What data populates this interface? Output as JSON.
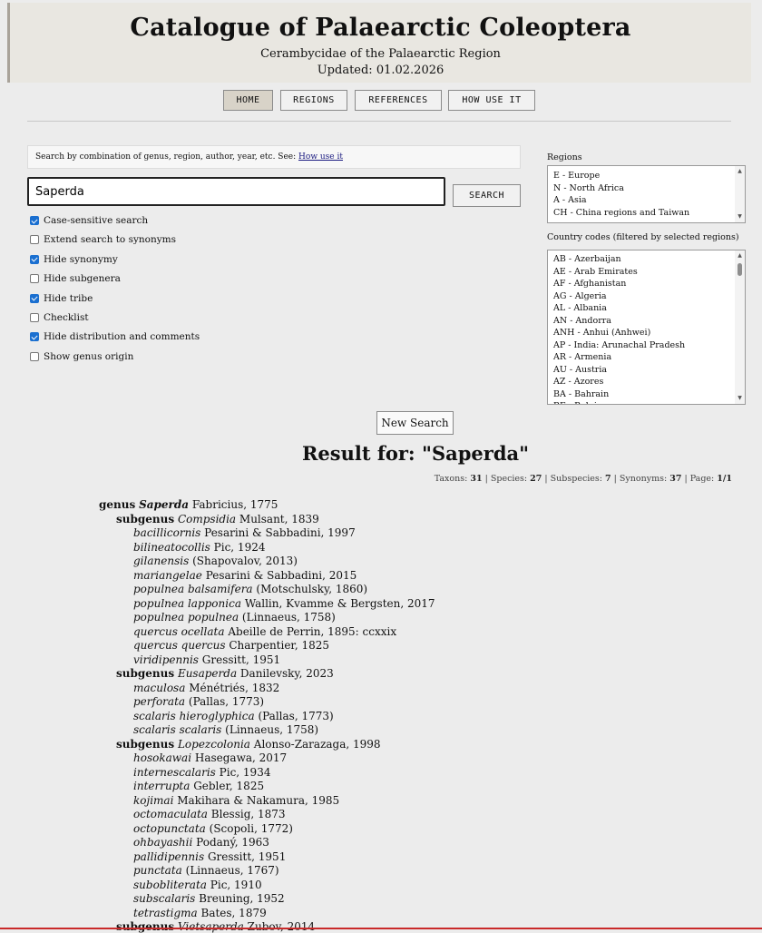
{
  "header": {
    "title": "Catalogue of Palaearctic Coleoptera",
    "subtitle": "Cerambycidae of the Palaearctic Region",
    "updated": "Updated: 01.02.2026"
  },
  "nav": [
    {
      "label": "HOME",
      "active": true
    },
    {
      "label": "REGIONS",
      "active": false
    },
    {
      "label": "REFERENCES",
      "active": false
    },
    {
      "label": "HOW USE IT",
      "active": false
    }
  ],
  "search": {
    "hint_text": "Search by combination of genus, region, author, year, etc. See:",
    "hint_link": "How use it",
    "value": "Saperda",
    "button": "SEARCH"
  },
  "options": [
    {
      "label": "Case-sensitive search",
      "checked": true
    },
    {
      "label": "Extend search to synonyms",
      "checked": false
    },
    {
      "label": "Hide synonymy",
      "checked": true
    },
    {
      "label": "Hide subgenera",
      "checked": false
    },
    {
      "label": "Hide tribe",
      "checked": true
    },
    {
      "label": "Checklist",
      "checked": false
    },
    {
      "label": "Hide distribution and comments",
      "checked": true
    },
    {
      "label": "Show genus origin",
      "checked": false
    }
  ],
  "regions": {
    "label": "Regions",
    "items": [
      "E - Europe",
      "N - North Africa",
      "A - Asia",
      "CH - China regions and Taiwan"
    ]
  },
  "countries": {
    "label": "Country codes (filtered by selected regions)",
    "items": [
      "AB - Azerbaijan",
      "AE - Arab Emirates",
      "AF - Afghanistan",
      "AG - Algeria",
      "AL - Albania",
      "AN - Andorra",
      "ANH - Anhui (Anhwei)",
      "AP - India: Arunachal Pradesh",
      "AR - Armenia",
      "AU - Austria",
      "AZ - Azores",
      "BA - Bahrain",
      "BE - Belgium"
    ]
  },
  "new_search": "New Search",
  "result": {
    "title": "Result for: \"Saperda\"",
    "stats": {
      "taxons_label": "Taxons:",
      "taxons": "31",
      "species_label": "Species:",
      "species": "27",
      "subspecies_label": "Subspecies:",
      "subspecies": "7",
      "synonyms_label": "Synonyms:",
      "synonyms": "37",
      "page_label": "Page:",
      "page": "1/1"
    }
  },
  "taxa": [
    {
      "level": 0,
      "rank": "genus",
      "name": "Saperda",
      "author": "Fabricius, 1775"
    },
    {
      "level": 1,
      "rank": "subgenus",
      "name": "Compsidia",
      "author": "Mulsant, 1839"
    },
    {
      "level": 2,
      "rank": "",
      "name": "bacillicornis",
      "author": "Pesarini & Sabbadini, 1997"
    },
    {
      "level": 2,
      "rank": "",
      "name": "bilineatocollis",
      "author": "Pic, 1924"
    },
    {
      "level": 2,
      "rank": "",
      "name": "gilanensis",
      "author": "(Shapovalov, 2013)"
    },
    {
      "level": 2,
      "rank": "",
      "name": "mariangelae",
      "author": "Pesarini & Sabbadini, 2015"
    },
    {
      "level": 2,
      "rank": "",
      "name": "populnea balsamifera",
      "author": "(Motschulsky, 1860)"
    },
    {
      "level": 2,
      "rank": "",
      "name": "populnea lapponica",
      "author": "Wallin, Kvamme & Bergsten, 2017"
    },
    {
      "level": 2,
      "rank": "",
      "name": "populnea populnea",
      "author": "(Linnaeus, 1758)"
    },
    {
      "level": 2,
      "rank": "",
      "name": "quercus ocellata",
      "author": "Abeille de Perrin, 1895: ccxxix"
    },
    {
      "level": 2,
      "rank": "",
      "name": "quercus quercus",
      "author": "Charpentier, 1825"
    },
    {
      "level": 2,
      "rank": "",
      "name": "viridipennis",
      "author": "Gressitt, 1951"
    },
    {
      "level": 1,
      "rank": "subgenus",
      "name": "Eusaperda",
      "author": "Danilevsky, 2023"
    },
    {
      "level": 2,
      "rank": "",
      "name": "maculosa",
      "author": "Ménétriés, 1832"
    },
    {
      "level": 2,
      "rank": "",
      "name": "perforata",
      "author": "(Pallas, 1773)"
    },
    {
      "level": 2,
      "rank": "",
      "name": "scalaris hieroglyphica",
      "author": "(Pallas, 1773)"
    },
    {
      "level": 2,
      "rank": "",
      "name": "scalaris scalaris",
      "author": "(Linnaeus, 1758)"
    },
    {
      "level": 1,
      "rank": "subgenus",
      "name": "Lopezcolonia",
      "author": "Alonso-Zarazaga, 1998"
    },
    {
      "level": 2,
      "rank": "",
      "name": "hosokawai",
      "author": "Hasegawa, 2017"
    },
    {
      "level": 2,
      "rank": "",
      "name": "internescalaris",
      "author": "Pic, 1934"
    },
    {
      "level": 2,
      "rank": "",
      "name": "interrupta",
      "author": "Gebler, 1825"
    },
    {
      "level": 2,
      "rank": "",
      "name": "kojimai",
      "author": "Makihara & Nakamura, 1985"
    },
    {
      "level": 2,
      "rank": "",
      "name": "octomaculata",
      "author": "Blessig, 1873"
    },
    {
      "level": 2,
      "rank": "",
      "name": "octopunctata",
      "author": "(Scopoli, 1772)"
    },
    {
      "level": 2,
      "rank": "",
      "name": "ohbayashii",
      "author": "Podaný, 1963"
    },
    {
      "level": 2,
      "rank": "",
      "name": "pallidipennis",
      "author": "Gressitt, 1951"
    },
    {
      "level": 2,
      "rank": "",
      "name": "punctata",
      "author": "(Linnaeus, 1767)"
    },
    {
      "level": 2,
      "rank": "",
      "name": "subobliterata",
      "author": "Pic, 1910"
    },
    {
      "level": 2,
      "rank": "",
      "name": "subscalaris",
      "author": "Breuning, 1952"
    },
    {
      "level": 2,
      "rank": "",
      "name": "tetrastigma",
      "author": "Bates, 1879"
    },
    {
      "level": 1,
      "rank": "subgenus",
      "name": "Vietsaperda",
      "author": "Zubov, 2014"
    }
  ]
}
